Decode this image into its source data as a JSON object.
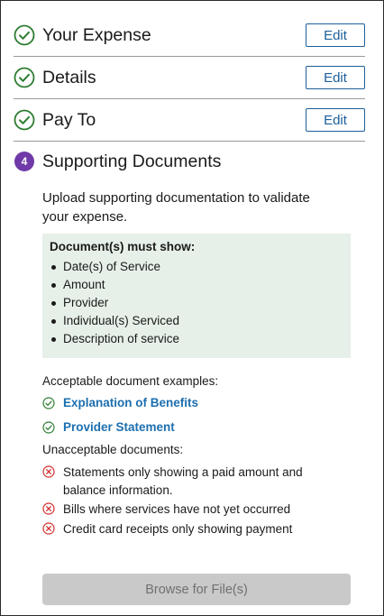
{
  "completed_steps": [
    {
      "title": "Your Expense",
      "edit_label": "Edit"
    },
    {
      "title": "Details",
      "edit_label": "Edit"
    },
    {
      "title": "Pay To",
      "edit_label": "Edit"
    }
  ],
  "current_step": {
    "number": "4",
    "title": "Supporting Documents",
    "intro": "Upload supporting documentation to validate your expense.",
    "must_show": {
      "title": "Document(s) must show:",
      "items": [
        "Date(s) of Service",
        "Amount",
        "Provider",
        "Individual(s) Serviced",
        "Description of service"
      ]
    },
    "acceptable": {
      "label": "Acceptable document examples:",
      "items": [
        "Explanation of Benefits",
        "Provider Statement"
      ]
    },
    "unacceptable": {
      "label": "Unacceptable documents:",
      "items": [
        "Statements only showing a paid amount and balance information.",
        "Bills where services have not yet occurred",
        "Credit card receipts only showing payment"
      ]
    },
    "browse_label": "Browse for File(s)"
  },
  "colors": {
    "check_green": "#2e7d32",
    "step_badge": "#6f3aa7",
    "link_blue": "#1c6fb0",
    "error_red": "#d32f2f",
    "box_bg": "#e6f0e8"
  }
}
